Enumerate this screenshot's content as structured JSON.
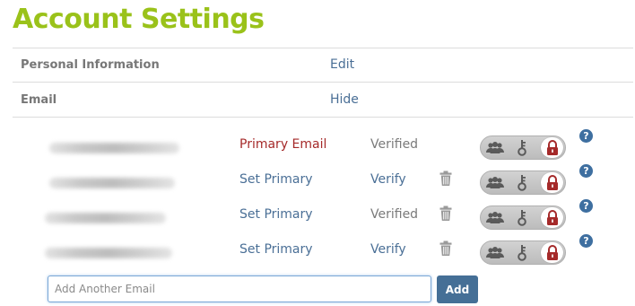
{
  "page": {
    "title": "Account Settings"
  },
  "sections": [
    {
      "label": "Personal Information",
      "action": "Edit"
    },
    {
      "label": "Email",
      "action": "Hide"
    }
  ],
  "emails": [
    {
      "address_visibility": "blurred",
      "primary_label": "Primary Email",
      "is_primary": true,
      "status": "Verified",
      "verified": true,
      "deletable": false,
      "privacy": "private",
      "help": "?"
    },
    {
      "address_visibility": "blurred",
      "primary_label": "Set Primary",
      "is_primary": false,
      "status": "Verify",
      "verified": false,
      "deletable": true,
      "privacy": "private",
      "help": "?"
    },
    {
      "address_visibility": "blurred",
      "primary_label": "Set Primary",
      "is_primary": false,
      "status": "Verified",
      "verified": true,
      "deletable": true,
      "privacy": "private",
      "help": "?"
    },
    {
      "address_visibility": "blurred",
      "primary_label": "Set Primary",
      "is_primary": false,
      "status": "Verify",
      "verified": false,
      "deletable": true,
      "privacy": "private",
      "help": "?"
    }
  ],
  "privacy_options": [
    "people-icon",
    "key-icon",
    "lock-icon"
  ],
  "add_email": {
    "placeholder": "Add Another Email",
    "value": "",
    "button_label": "Add"
  },
  "colors": {
    "title": "#9ac21a",
    "link": "#4a6f96",
    "primary": "#a52a2a",
    "lock": "#a52a2a",
    "button": "#456f96",
    "help": "#3e6fa0"
  }
}
